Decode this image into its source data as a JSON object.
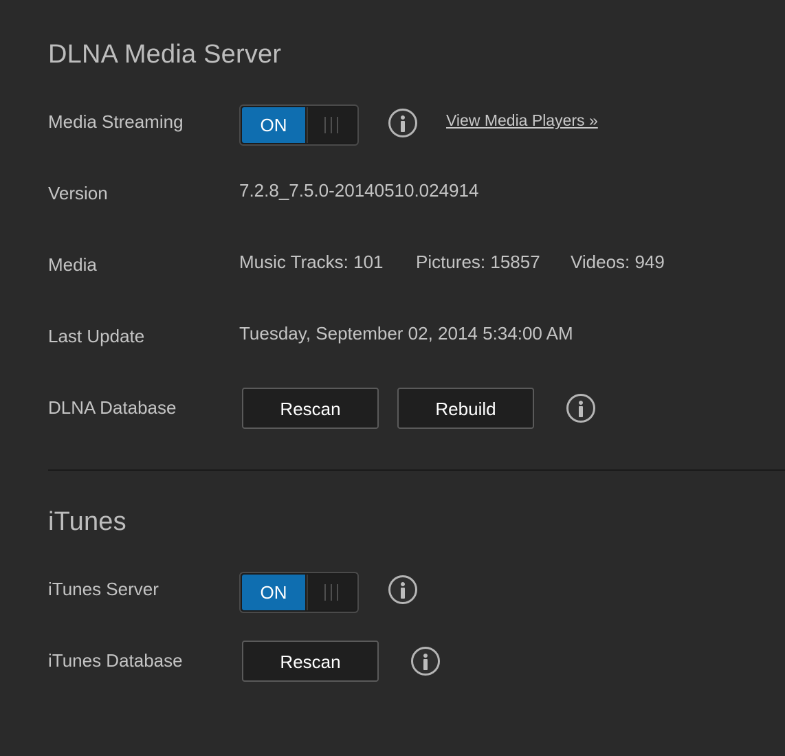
{
  "dlna": {
    "title": "DLNA Media Server",
    "streaming": {
      "label": "Media Streaming",
      "toggle_on_label": "ON",
      "toggle_state": true,
      "link_label": "View Media Players »"
    },
    "version": {
      "label": "Version",
      "value": "7.2.8_7.5.0-20140510.024914"
    },
    "media": {
      "label": "Media",
      "music": "Music Tracks: 101",
      "pictures": "Pictures: 15857",
      "videos": "Videos: 949"
    },
    "last_update": {
      "label": "Last Update",
      "value": "Tuesday, September 02, 2014 5:34:00 AM"
    },
    "database": {
      "label": "DLNA Database",
      "rescan_label": "Rescan",
      "rebuild_label": "Rebuild"
    }
  },
  "itunes": {
    "title": "iTunes",
    "server": {
      "label": "iTunes Server",
      "toggle_on_label": "ON",
      "toggle_state": true
    },
    "database": {
      "label": "iTunes Database",
      "rescan_label": "Rescan"
    }
  },
  "colors": {
    "background": "#2a2a2a",
    "toggle_on": "#0f6eb0",
    "text": "#c4c4c4",
    "button_bg": "#1f1f1f"
  },
  "icons": {
    "info": "info-circle-icon",
    "grip": "toggle-grip-icon"
  }
}
